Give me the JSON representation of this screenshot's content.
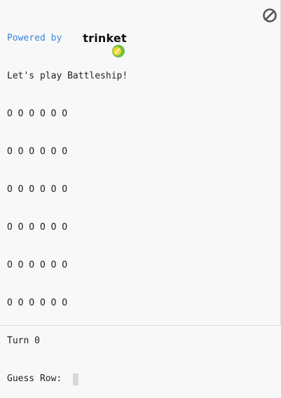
{
  "header": {
    "powered_label": "Powered by",
    "brand": "trinket"
  },
  "console": {
    "intro": "Let's play Battleship!",
    "board": [
      "O O O O O O",
      "O O O O O O",
      "O O O O O O",
      "O O O O O O",
      "O O O O O O",
      "O O O O O O"
    ],
    "turn": "Turn 0",
    "prompt": "Guess Row: "
  },
  "controls": {
    "stop_icon": "stop-icon"
  },
  "colors": {
    "background": "#f8f8f8",
    "link": "#3b84d8",
    "logo_green": "#6cc04a",
    "logo_yellow": "#f5d327",
    "stop_icon": "#555555"
  }
}
